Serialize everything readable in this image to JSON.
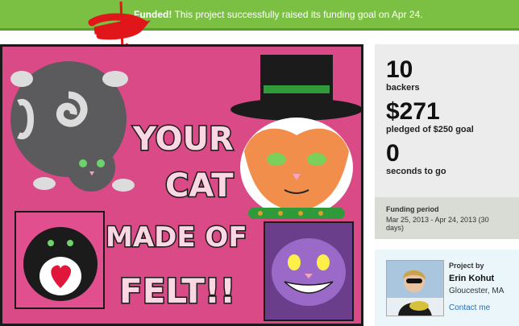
{
  "banner": {
    "status": "Funded!",
    "message": " This project successfully raised its funding goal on Apr 24."
  },
  "hero": {
    "line1": "YOUR",
    "line2": "CAT",
    "line3": "MADE OF",
    "line4": "FELT!!"
  },
  "stats": {
    "backers_count": "10",
    "backers_label": "backers",
    "pledged_amount": "$271",
    "pledged_label": "pledged of $250 goal",
    "time_count": "0",
    "time_label": "seconds to go"
  },
  "funding": {
    "label": "Funding period",
    "dates": "Mar 25, 2013 - Apr 24, 2013 (30 days)"
  },
  "creator": {
    "project_by": "Project by",
    "name": "Erin Kohut",
    "location": "Gloucester, MA",
    "contact": "Contact me"
  },
  "colors": {
    "banner_green": "#7cc043",
    "hero_pink": "#d94a86",
    "link_blue": "#2a6ebb"
  }
}
